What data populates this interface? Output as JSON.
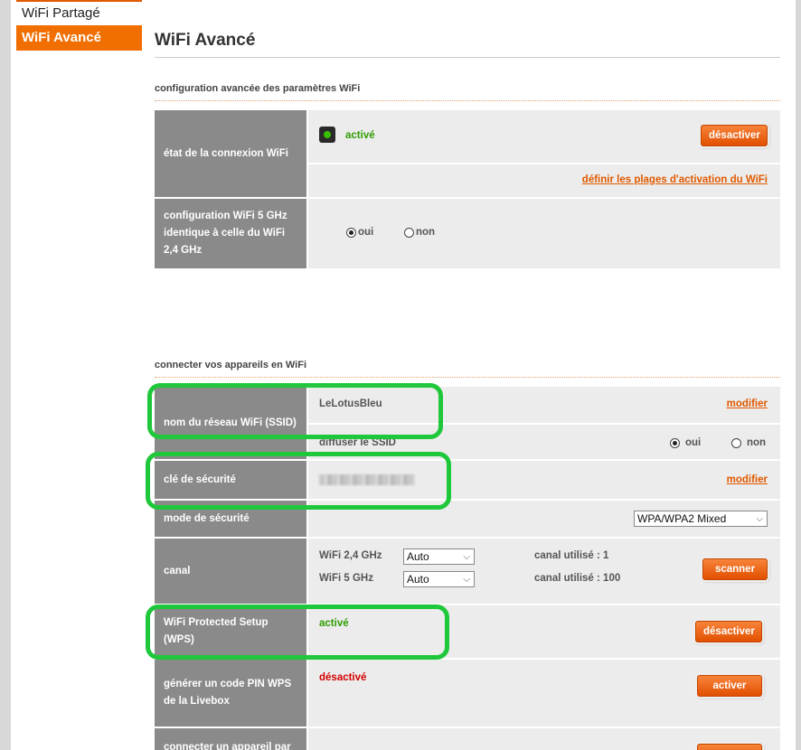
{
  "nav": {
    "items": [
      "WiFi Partagé",
      "WiFi Avancé"
    ]
  },
  "page_title": "WiFi Avancé",
  "section1": {
    "label": "configuration avancée des paramètres WiFi",
    "connection_state": {
      "label": "état de la connexion WiFi",
      "status": "activé",
      "button": "désactiver",
      "link": "définir les plages d'activation du WiFi"
    },
    "same_config": {
      "label": "configuration WiFi 5 GHz identique à celle du WiFi 2,4 GHz",
      "options": [
        "oui",
        "non"
      ],
      "selected": "oui"
    }
  },
  "section2": {
    "label": "connecter vos appareils en WiFi",
    "ssid": {
      "label": "nom du réseau WiFi (SSID)",
      "value": "LeLotusBleu",
      "modify": "modifier",
      "broadcast_label": "diffuser le SSID",
      "options": [
        "oui",
        "non"
      ],
      "selected": "oui"
    },
    "security_key": {
      "label": "clé de sécurité",
      "modify": "modifier"
    },
    "security_mode": {
      "label": "mode de sécurité",
      "selected": "WPA/WPA2 Mixed"
    },
    "channel": {
      "label": "canal",
      "band24_label": "WiFi 2,4 GHz",
      "band24_value": "Auto",
      "band24_used": "canal utilisé : 1",
      "band5_label": "WiFi 5 GHz",
      "band5_value": "Auto",
      "band5_used": "canal utilisé : 100",
      "button": "scanner"
    },
    "wps": {
      "label": "WiFi Protected Setup (WPS)",
      "status": "activé",
      "button": "désactiver"
    },
    "wps_pin": {
      "label": "générer un code PIN WPS de la Livebox",
      "status": "désactivé",
      "button": "activer"
    },
    "connect_device": {
      "label": "connecter un appareil par"
    }
  },
  "colors": {
    "accent": "#f16e00",
    "label_cell": "#8a8a8a",
    "value_cell": "#ececec",
    "active_green": "#2f9c00",
    "inactive_red": "#d40000",
    "highlight_green": "#1ec83a"
  }
}
